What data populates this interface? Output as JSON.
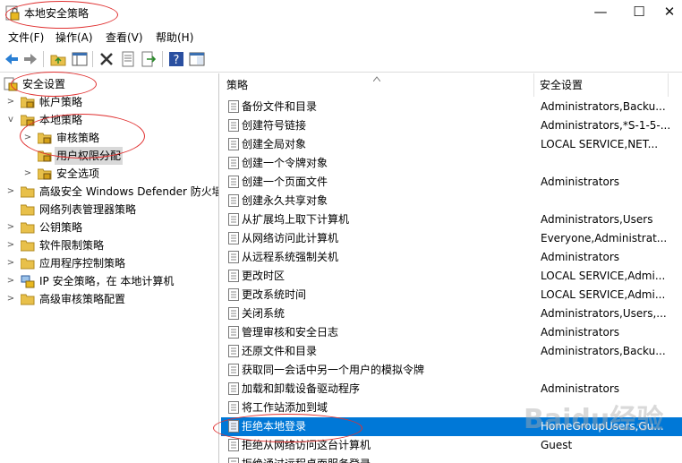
{
  "window": {
    "title": "本地安全策略",
    "minimize": "—",
    "maximize": "☐",
    "close": "✕"
  },
  "menu": [
    "文件(F)",
    "操作(A)",
    "查看(V)",
    "帮助(H)"
  ],
  "toolbar": [
    "back-arrow-icon",
    "forward-arrow-icon",
    "up-folder-icon",
    "show-tree-icon",
    "delete-icon",
    "properties-icon",
    "export-icon",
    "help-icon",
    "console-icon"
  ],
  "tree": [
    {
      "label": "安全设置",
      "icon": "security-settings-icon",
      "expander": ""
    },
    {
      "label": "帐户策略",
      "icon": "folder-lock-icon",
      "expander": ">"
    },
    {
      "label": "本地策略",
      "icon": "folder-lock-icon",
      "expander": "v"
    },
    {
      "label": "审核策略",
      "icon": "folder-lock-icon",
      "expander": ">"
    },
    {
      "label": "用户权限分配",
      "icon": "folder-lock-icon",
      "expander": ""
    },
    {
      "label": "安全选项",
      "icon": "folder-lock-icon",
      "expander": ">"
    },
    {
      "label": "高级安全 Windows Defender 防火墙",
      "icon": "folder-icon",
      "expander": ">"
    },
    {
      "label": "网络列表管理器策略",
      "icon": "folder-icon",
      "expander": ""
    },
    {
      "label": "公钥策略",
      "icon": "folder-icon",
      "expander": ">"
    },
    {
      "label": "软件限制策略",
      "icon": "folder-icon",
      "expander": ">"
    },
    {
      "label": "应用程序控制策略",
      "icon": "folder-icon",
      "expander": ">"
    },
    {
      "label": "IP 安全策略，在 本地计算机",
      "icon": "ip-security-icon",
      "expander": ">"
    },
    {
      "label": "高级审核策略配置",
      "icon": "folder-icon",
      "expander": ">"
    }
  ],
  "columns": {
    "policy": "策略",
    "setting": "安全设置"
  },
  "rows": [
    {
      "name": "备份文件和目录",
      "value": "Administrators,Backu..."
    },
    {
      "name": "创建符号链接",
      "value": "Administrators,*S-1-5-..."
    },
    {
      "name": "创建全局对象",
      "value": "LOCAL SERVICE,NET..."
    },
    {
      "name": "创建一个令牌对象",
      "value": ""
    },
    {
      "name": "创建一个页面文件",
      "value": "Administrators"
    },
    {
      "name": "创建永久共享对象",
      "value": ""
    },
    {
      "name": "从扩展坞上取下计算机",
      "value": "Administrators,Users"
    },
    {
      "name": "从网络访问此计算机",
      "value": "Everyone,Administrat..."
    },
    {
      "name": "从远程系统强制关机",
      "value": "Administrators"
    },
    {
      "name": "更改时区",
      "value": "LOCAL SERVICE,Admi..."
    },
    {
      "name": "更改系统时间",
      "value": "LOCAL SERVICE,Admi..."
    },
    {
      "name": "关闭系统",
      "value": "Administrators,Users,..."
    },
    {
      "name": "管理审核和安全日志",
      "value": "Administrators"
    },
    {
      "name": "还原文件和目录",
      "value": "Administrators,Backu..."
    },
    {
      "name": "获取同一会话中另一个用户的模拟令牌",
      "value": ""
    },
    {
      "name": "加载和卸载设备驱动程序",
      "value": "Administrators"
    },
    {
      "name": "将工作站添加到域",
      "value": ""
    },
    {
      "name": "拒绝本地登录",
      "value": "HomeGroupUsers,Gu..."
    },
    {
      "name": "拒绝从网络访问这台计算机",
      "value": "Guest"
    },
    {
      "name": "拒绝通过远程桌面服务登录",
      "value": ""
    }
  ],
  "watermark": "Baidu经验",
  "colors": {
    "selection": "#0078d7",
    "annotation": "#e03030"
  }
}
